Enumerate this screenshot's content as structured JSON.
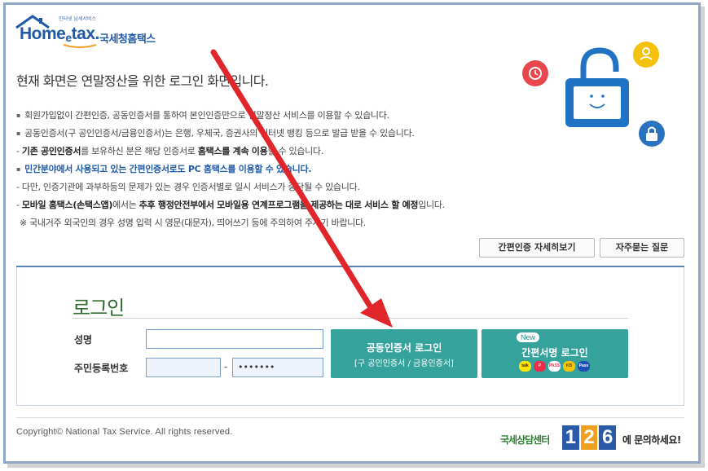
{
  "logo": {
    "small_text": "인터넷 납세서비스",
    "brand_home": "Home",
    "brand_e": "e",
    "brand_tax": "tax.",
    "brand_kr": "국세청홈택스"
  },
  "heading": "현재 화면은 연말정산을 위한 로그인 화면입니다.",
  "info": {
    "line1": "회원가입없이 간편인증, 공동인증서를 통하여 본인인증만으로 연말정산 서비스를 이용할 수 있습니다.",
    "line2": "공동인증서(구 공인인증서/금융인증서)는 은행, 우체국, 증권사의 인터넷 뱅킹 등으로 발급 받을 수 있습니다.",
    "line3_a": "기존 공인인증서",
    "line3_b": "를 보유하신 분은 해당 인증서로 ",
    "line3_c": "홈택스를 계속 이용",
    "line3_d": "할 수 있습니다.",
    "line4": "민간분야에서 사용되고 있는 간편인증서로도 PC 홈택스를 이용할 수 있습니다.",
    "line5": "다만, 인증기관에 과부하등의 문제가 있는 경우 인증서별로 일시 서비스가 중단될 수 있습니다.",
    "line6_a": "모바일 홈택스(손택스앱)",
    "line6_b": "에서는 ",
    "line6_c": "추후 행정안전부에서 모바일용 연계프로그램을 제공하는 대로 서비스 할 예정",
    "line6_d": "입니다.",
    "line7": "※ 국내거주 외국인의 경우 성명 입력 시 영문(대문자), 띄어쓰기 등에 주의하여 주시기 바랍니다."
  },
  "buttons": {
    "easy_auth_detail": "간편인증 자세히보기",
    "faq": "자주묻는 질문"
  },
  "login": {
    "title": "로그인",
    "name_label": "성명",
    "name_value": "",
    "rrn_label": "주민등록번호",
    "rrn_front": "",
    "rrn_dash": "-",
    "rrn_back": "•••••••",
    "cert_login_title": "공동인증서 로그인",
    "cert_login_sub": "[구 공인인증서 / 금융인증서]",
    "simple_badge": "New",
    "simple_login_title": "간편서명 로그인",
    "app_icons": [
      "kakao-icon",
      "payco-icon",
      "pass-icon",
      "kb-icon",
      "samsungpass-icon"
    ]
  },
  "footer": {
    "copyright": "Copyright© National Tax Service.  All rights reserved.",
    "callcenter_lead": "국세상담센터",
    "callcenter_num": [
      "1",
      "2",
      "6"
    ],
    "callcenter_tail": "에 문의하세요!"
  },
  "colors": {
    "brand_blue": "#1f5aa8",
    "teal_button": "#35a29c",
    "login_green": "#2f6a2f",
    "annotation_arrow": "#e0252b"
  }
}
